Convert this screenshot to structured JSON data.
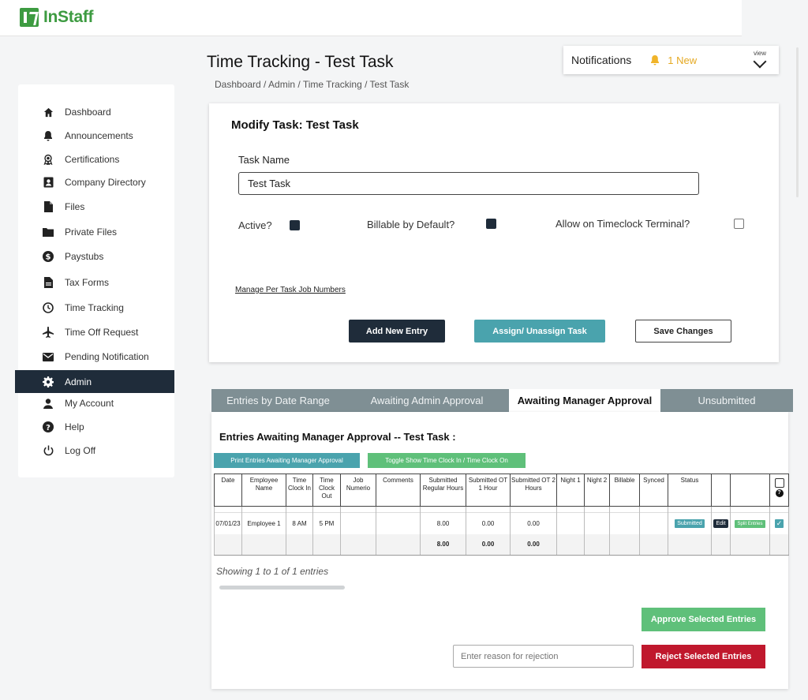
{
  "app": {
    "name": "InStaff",
    "brand_color": "#3d9b41"
  },
  "header": {
    "title": "Time Tracking",
    "title_sep": " - ",
    "title_sub": "Test Task",
    "breadcrumb": "Dashboard  / Admin / Time Tracking / Test Task"
  },
  "notifications": {
    "label": "Notifications",
    "count": "1 New",
    "view": "view"
  },
  "sidebar": {
    "items": [
      {
        "label": "Dashboard",
        "icon": "home-icon"
      },
      {
        "label": "Announcements",
        "icon": "bell-icon"
      },
      {
        "label": "Certifications",
        "icon": "award-icon"
      },
      {
        "label": "Company Directory",
        "icon": "contact-card-icon"
      },
      {
        "label": "Files",
        "icon": "file-icon"
      },
      {
        "label": "Private Files",
        "icon": "folder-icon"
      },
      {
        "label": "Paystubs",
        "icon": "dollar-icon"
      },
      {
        "label": "Tax Forms",
        "icon": "document-icon"
      },
      {
        "label": "Time Tracking",
        "icon": "clock-icon"
      },
      {
        "label": "Time Off Request",
        "icon": "airplane-icon"
      },
      {
        "label": "Pending Notification",
        "icon": "mail-icon"
      },
      {
        "label": "Admin",
        "icon": "gear-icon",
        "active": true
      },
      {
        "label": "My Account",
        "icon": "person-icon"
      },
      {
        "label": "Help",
        "icon": "help-icon"
      },
      {
        "label": "Log Off",
        "icon": "power-icon"
      }
    ]
  },
  "modify": {
    "title": "Modify Task: Test Task",
    "task_name_label": "Task Name",
    "task_name_value": "Test Task",
    "active_label": "Active?",
    "billable_label": "Billable by Default?",
    "timeclock_label": "Allow on Timeclock Terminal?",
    "manage_link": "Manage Per Task Job Numbers",
    "add_entry": "Add New Entry",
    "assign": "Assign/ Unassign Task",
    "save": "Save Changes"
  },
  "tabs": [
    {
      "label": "Entries by Date Range"
    },
    {
      "label": "Awaiting Admin Approval"
    },
    {
      "label": "Awaiting Manager Approval",
      "active": true
    },
    {
      "label": "Unsubmitted"
    }
  ],
  "panel": {
    "title": "Entries Awaiting Manager Approval -- Test Task :",
    "print_button": "Print Entries Awaiting Manager Approval",
    "toggle_button": "Toggle Show Time Clock In /  Time Clock On",
    "columns": [
      "Date",
      "Employee Name",
      "Time Clock In",
      "Time Clock Out",
      "Job Numerio",
      "Comments",
      "Submitted Regular Hours",
      "Submitted OT 1 Hour",
      "Submitted OT 2 Hours",
      "Night 1",
      "Night 2",
      "Billable",
      "Synced",
      "Status",
      "",
      "",
      ""
    ],
    "rows": [
      {
        "date": "07/01/23",
        "employee": "Employee 1",
        "clock_in": "8 AM",
        "clock_out": "5 PM",
        "job": "",
        "comments": "",
        "regular": "8.00",
        "ot1": "0.00",
        "ot2": "0.00",
        "night1": "",
        "night2": "",
        "billable": "",
        "synced": "",
        "status": "Submitted",
        "edit": "Edit",
        "split": "Split Entries"
      }
    ],
    "totals": {
      "regular": "8.00",
      "ot1": "0.00",
      "ot2": "0.00"
    },
    "showing": "Showing 1 to 1 of 1 entries",
    "approve": "Approve Selected Entries",
    "reject_placeholder": "Enter reason for rejection",
    "reject": "Reject Selected Entries",
    "help_glyph": "?",
    "check_glyph": "✓"
  }
}
